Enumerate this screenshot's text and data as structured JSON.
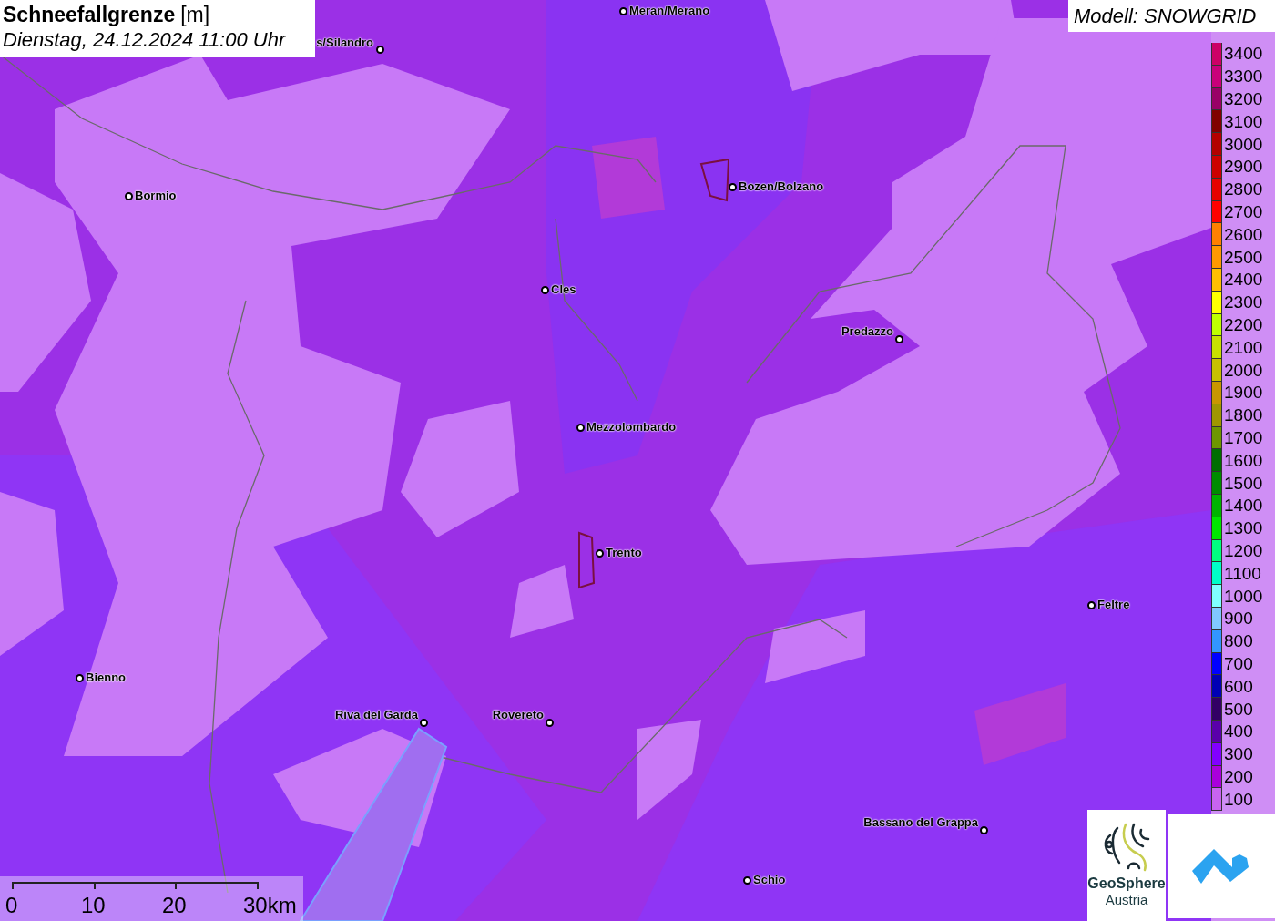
{
  "header": {
    "title": "Schneefallgrenze",
    "unit": "[m]",
    "datetime": "Dienstag, 24.12.2024 11:00 Uhr"
  },
  "model": "Modell: SNOWGRID",
  "places": [
    {
      "name": "s/Silandro"
    },
    {
      "name": "Meran/Merano"
    },
    {
      "name": "Bormio"
    },
    {
      "name": "Bozen/Bolzano"
    },
    {
      "name": "Cles"
    },
    {
      "name": "Predazzo"
    },
    {
      "name": "Mezzolombardo"
    },
    {
      "name": "Trento"
    },
    {
      "name": "Feltre"
    },
    {
      "name": "Bienno"
    },
    {
      "name": "Riva del Garda"
    },
    {
      "name": "Rovereto"
    },
    {
      "name": "Bassano del Grappa"
    },
    {
      "name": "Schio"
    }
  ],
  "legend": [
    {
      "label": "3400",
      "color": "#cc0066"
    },
    {
      "label": "3300",
      "color": "#c8007a"
    },
    {
      "label": "3200",
      "color": "#990066"
    },
    {
      "label": "3100",
      "color": "#800000"
    },
    {
      "label": "3000",
      "color": "#b30000"
    },
    {
      "label": "2900",
      "color": "#cc0000"
    },
    {
      "label": "2800",
      "color": "#e60000"
    },
    {
      "label": "2700",
      "color": "#ff0000"
    },
    {
      "label": "2600",
      "color": "#ff8000"
    },
    {
      "label": "2500",
      "color": "#ff9900"
    },
    {
      "label": "2400",
      "color": "#ffbf00"
    },
    {
      "label": "2300",
      "color": "#ffff00"
    },
    {
      "label": "2200",
      "color": "#bfff00"
    },
    {
      "label": "2100",
      "color": "#c8e000"
    },
    {
      "label": "2000",
      "color": "#c8c000"
    },
    {
      "label": "1900",
      "color": "#c89600"
    },
    {
      "label": "1800",
      "color": "#a09600"
    },
    {
      "label": "1700",
      "color": "#6e9600"
    },
    {
      "label": "1600",
      "color": "#006e00"
    },
    {
      "label": "1500",
      "color": "#008c00"
    },
    {
      "label": "1400",
      "color": "#00b400"
    },
    {
      "label": "1300",
      "color": "#00e600"
    },
    {
      "label": "1200",
      "color": "#00ff80"
    },
    {
      "label": "1100",
      "color": "#00ffc8"
    },
    {
      "label": "1000",
      "color": "#80ffff"
    },
    {
      "label": "900",
      "color": "#80c8ff"
    },
    {
      "label": "800",
      "color": "#3296ff"
    },
    {
      "label": "700",
      "color": "#0000ff"
    },
    {
      "label": "600",
      "color": "#0000b4"
    },
    {
      "label": "500",
      "color": "#320064"
    },
    {
      "label": "400",
      "color": "#5a00aa"
    },
    {
      "label": "300",
      "color": "#8200ff"
    },
    {
      "label": "200",
      "color": "#aa00dc"
    },
    {
      "label": "100",
      "color": "#c864f0"
    }
  ],
  "scale": [
    "0",
    "10",
    "20",
    "30km"
  ],
  "logo": {
    "line1": "GeoSphere",
    "line2": "Austria"
  }
}
